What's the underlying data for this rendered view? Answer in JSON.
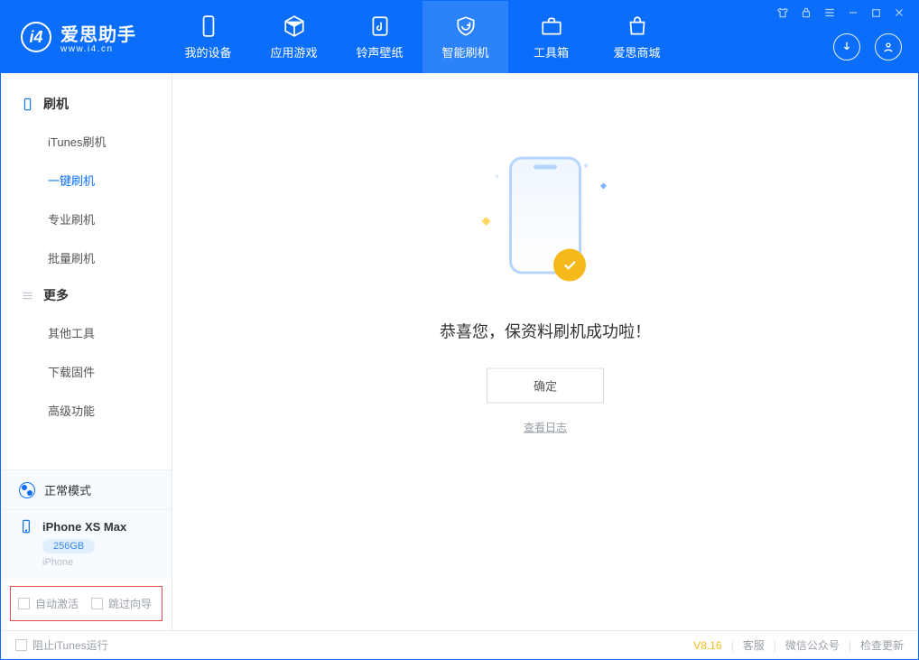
{
  "app": {
    "name_cn": "爱思助手",
    "name_en": "www.i4.cn"
  },
  "nav": {
    "items": [
      {
        "label": "我的设备"
      },
      {
        "label": "应用游戏"
      },
      {
        "label": "铃声壁纸"
      },
      {
        "label": "智能刷机"
      },
      {
        "label": "工具箱"
      },
      {
        "label": "爱思商城"
      }
    ]
  },
  "sidebar": {
    "group_flash": "刷机",
    "group_more": "更多",
    "items_flash": [
      {
        "label": "iTunes刷机"
      },
      {
        "label": "一键刷机"
      },
      {
        "label": "专业刷机"
      },
      {
        "label": "批量刷机"
      }
    ],
    "items_more": [
      {
        "label": "其他工具"
      },
      {
        "label": "下载固件"
      },
      {
        "label": "高级功能"
      }
    ],
    "mode_label": "正常模式",
    "device": {
      "name": "iPhone XS Max",
      "capacity": "256GB",
      "type": "iPhone"
    },
    "checks": {
      "auto_activate": "自动激活",
      "skip_wizard": "跳过向导"
    }
  },
  "main": {
    "success_title": "恭喜您，保资料刷机成功啦！",
    "confirm_label": "确定",
    "view_log_label": "查看日志"
  },
  "footer": {
    "block_itunes": "阻止iTunes运行",
    "version": "V8.16",
    "links": {
      "support": "客服",
      "wechat": "微信公众号",
      "check_update": "检查更新"
    }
  }
}
